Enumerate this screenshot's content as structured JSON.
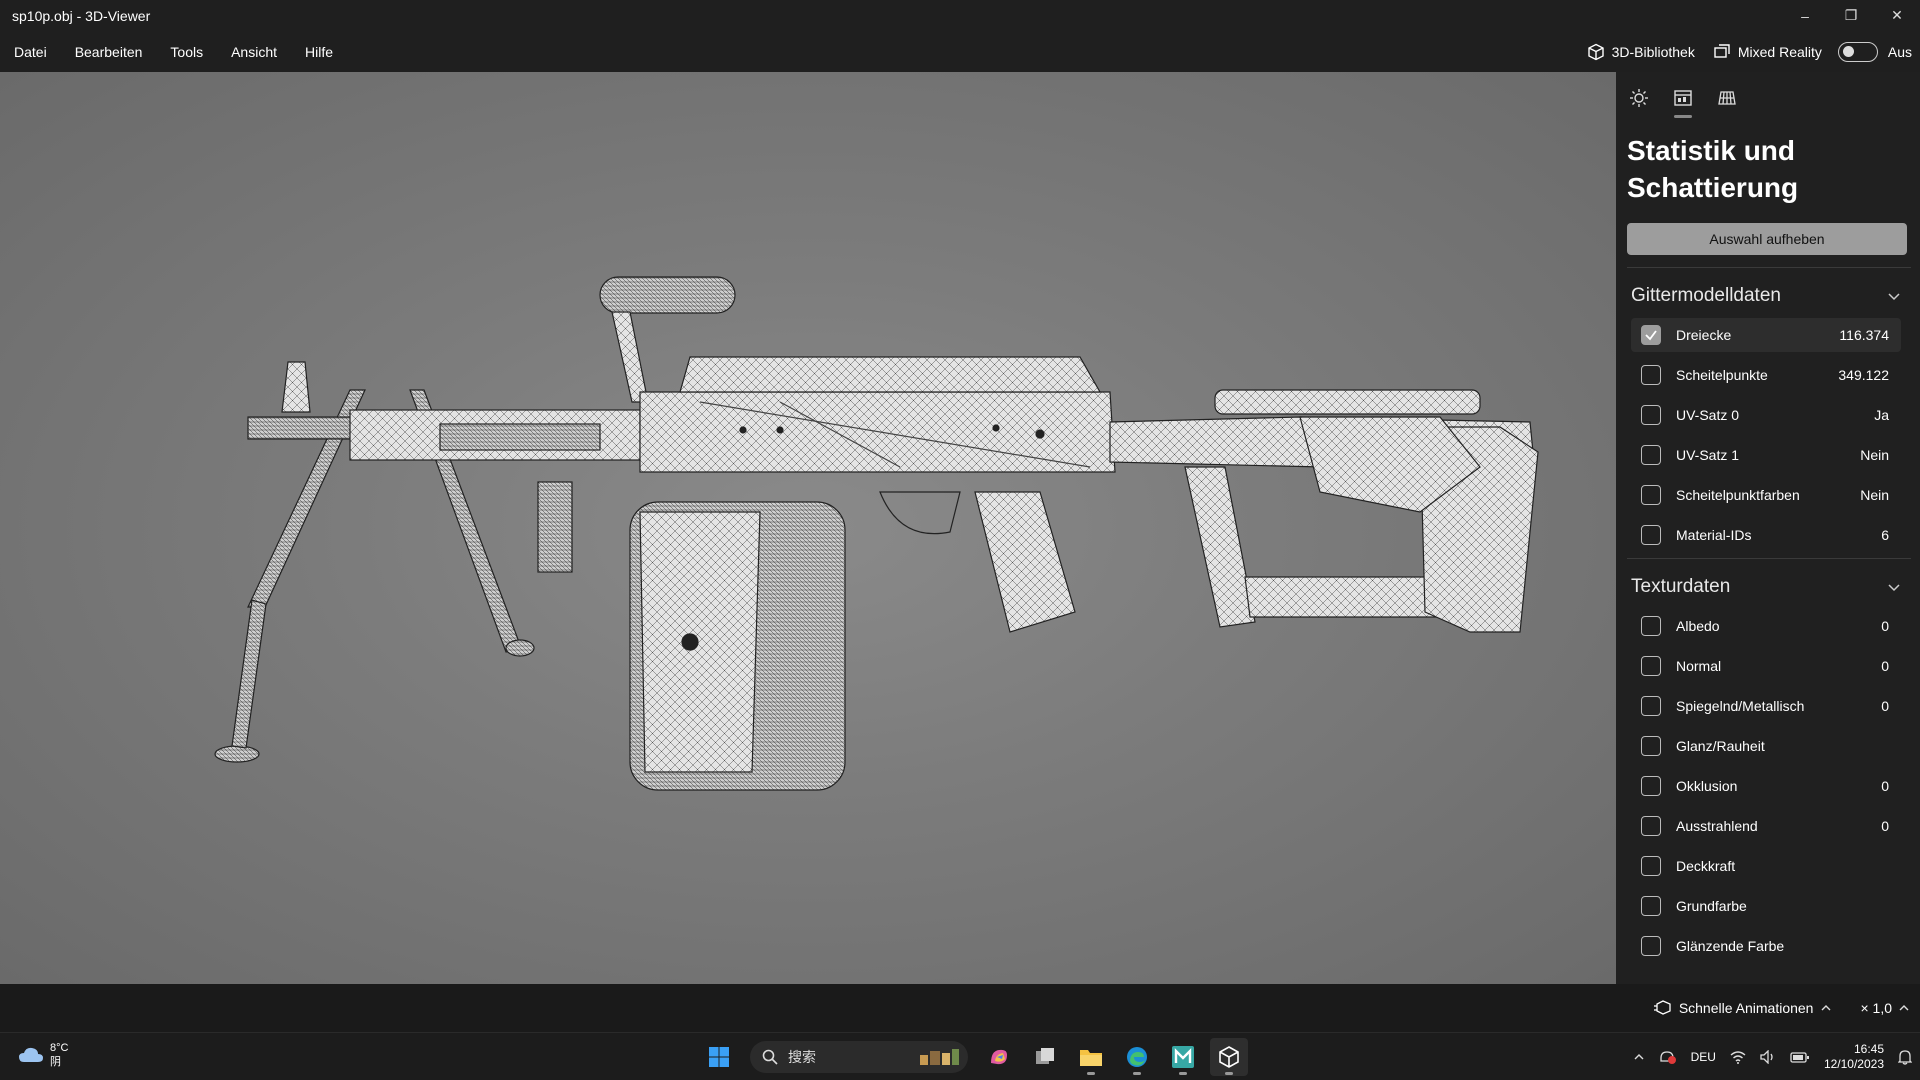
{
  "window": {
    "title": "sp10p.obj - 3D-Viewer",
    "minimize": "–",
    "maximize": "❐",
    "close": "✕"
  },
  "menu": {
    "items": [
      "Datei",
      "Bearbeiten",
      "Tools",
      "Ansicht",
      "Hilfe"
    ],
    "library_label": "3D-Bibliothek",
    "mixed_reality_label": "Mixed Reality",
    "toggle_state": "Aus"
  },
  "panel": {
    "title": "Statistik und Schattierung",
    "deselect_label": "Auswahl aufheben",
    "sections": [
      {
        "title": "Gittermodelldaten",
        "rows": [
          {
            "label": "Dreiecke",
            "value": "116.374",
            "checked": true
          },
          {
            "label": "Scheitelpunkte",
            "value": "349.122",
            "checked": false
          },
          {
            "label": "UV-Satz 0",
            "value": "Ja",
            "checked": false
          },
          {
            "label": "UV-Satz 1",
            "value": "Nein",
            "checked": false
          },
          {
            "label": "Scheitelpunktfarben",
            "value": "Nein",
            "checked": false
          },
          {
            "label": "Material-IDs",
            "value": "6",
            "checked": false
          }
        ]
      },
      {
        "title": "Texturdaten",
        "rows": [
          {
            "label": "Albedo",
            "value": "0",
            "checked": false
          },
          {
            "label": "Normal",
            "value": "0",
            "checked": false
          },
          {
            "label": "Spiegelnd/Metallisch",
            "value": "0",
            "checked": false
          },
          {
            "label": "Glanz/Rauheit",
            "value": "",
            "checked": false
          },
          {
            "label": "Okklusion",
            "value": "0",
            "checked": false
          },
          {
            "label": "Ausstrahlend",
            "value": "0",
            "checked": false
          },
          {
            "label": "Deckkraft",
            "value": "",
            "checked": false
          },
          {
            "label": "Grundfarbe",
            "value": "",
            "checked": false
          },
          {
            "label": "Glänzende Farbe",
            "value": "",
            "checked": false
          }
        ]
      }
    ]
  },
  "statusbar": {
    "animations_label": "Schnelle Animationen",
    "speed": "× 1,0"
  },
  "taskbar": {
    "weather_temp": "8°C",
    "weather_cond": "阴",
    "search_placeholder": "搜索",
    "lang": "DEU",
    "time": "16:45",
    "date": "12/10/2023"
  },
  "colors": {
    "viewport_bg": "#7c7c7c",
    "panel_bg": "#202020",
    "accent_button": "#9d9d9d"
  }
}
